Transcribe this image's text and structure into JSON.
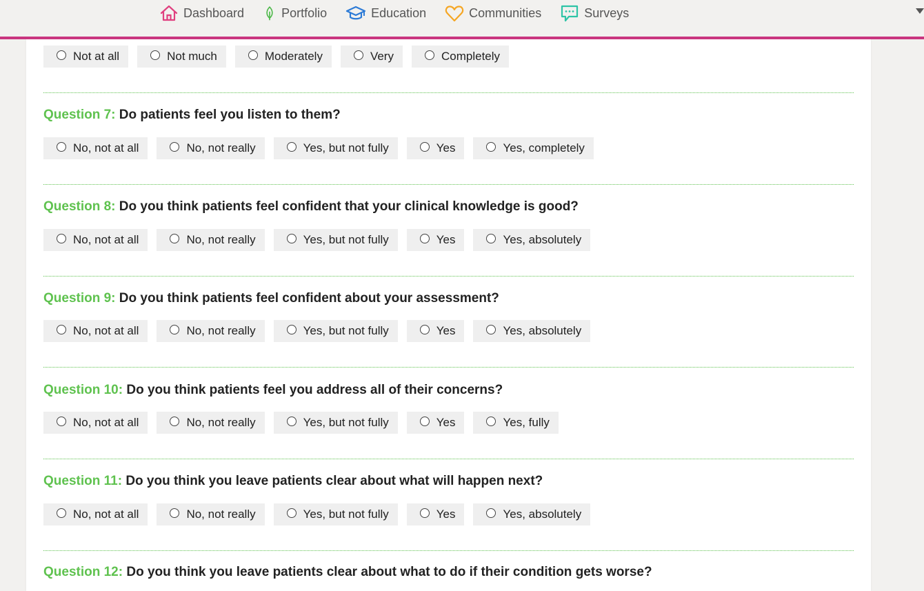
{
  "nav": {
    "items": [
      {
        "label": "Dashboard",
        "icon": "home-icon"
      },
      {
        "label": "Portfolio",
        "icon": "leaf-icon"
      },
      {
        "label": "Education",
        "icon": "graduation-cap-icon"
      },
      {
        "label": "Communities",
        "icon": "heart-icon"
      },
      {
        "label": "Surveys",
        "icon": "chat-bubble-icon"
      }
    ]
  },
  "colors": {
    "accent_bar": "#c9357f",
    "question_number": "#5fc24f",
    "divider": "#5fc24f",
    "option_bg": "#efefef"
  },
  "partial_options": [
    "Not at all",
    "Not much",
    "Moderately",
    "Very",
    "Completely"
  ],
  "questions": [
    {
      "number": "Question 7:",
      "text": "Do patients feel you listen to them?",
      "options": [
        "No, not at all",
        "No, not really",
        "Yes, but not fully",
        "Yes",
        "Yes, completely"
      ]
    },
    {
      "number": "Question 8:",
      "text": "Do you think patients feel confident that your clinical knowledge is good?",
      "options": [
        "No, not at all",
        "No, not really",
        "Yes, but not fully",
        "Yes",
        "Yes, absolutely"
      ]
    },
    {
      "number": "Question 9:",
      "text": "Do you think patients feel confident about your assessment?",
      "options": [
        "No, not at all",
        "No, not really",
        "Yes, but not fully",
        "Yes",
        "Yes, absolutely"
      ]
    },
    {
      "number": "Question 10:",
      "text": "Do you think patients feel you address all of their concerns?",
      "options": [
        "No, not at all",
        "No, not really",
        "Yes, but not fully",
        "Yes",
        "Yes, fully"
      ]
    },
    {
      "number": "Question 11:",
      "text": "Do you think you leave patients clear about what will happen next?",
      "options": [
        "No, not at all",
        "No, not really",
        "Yes, but not fully",
        "Yes",
        "Yes, absolutely"
      ]
    },
    {
      "number": "Question 12:",
      "text": "Do you think you leave patients clear about what to do if their condition gets worse?",
      "options": []
    }
  ]
}
